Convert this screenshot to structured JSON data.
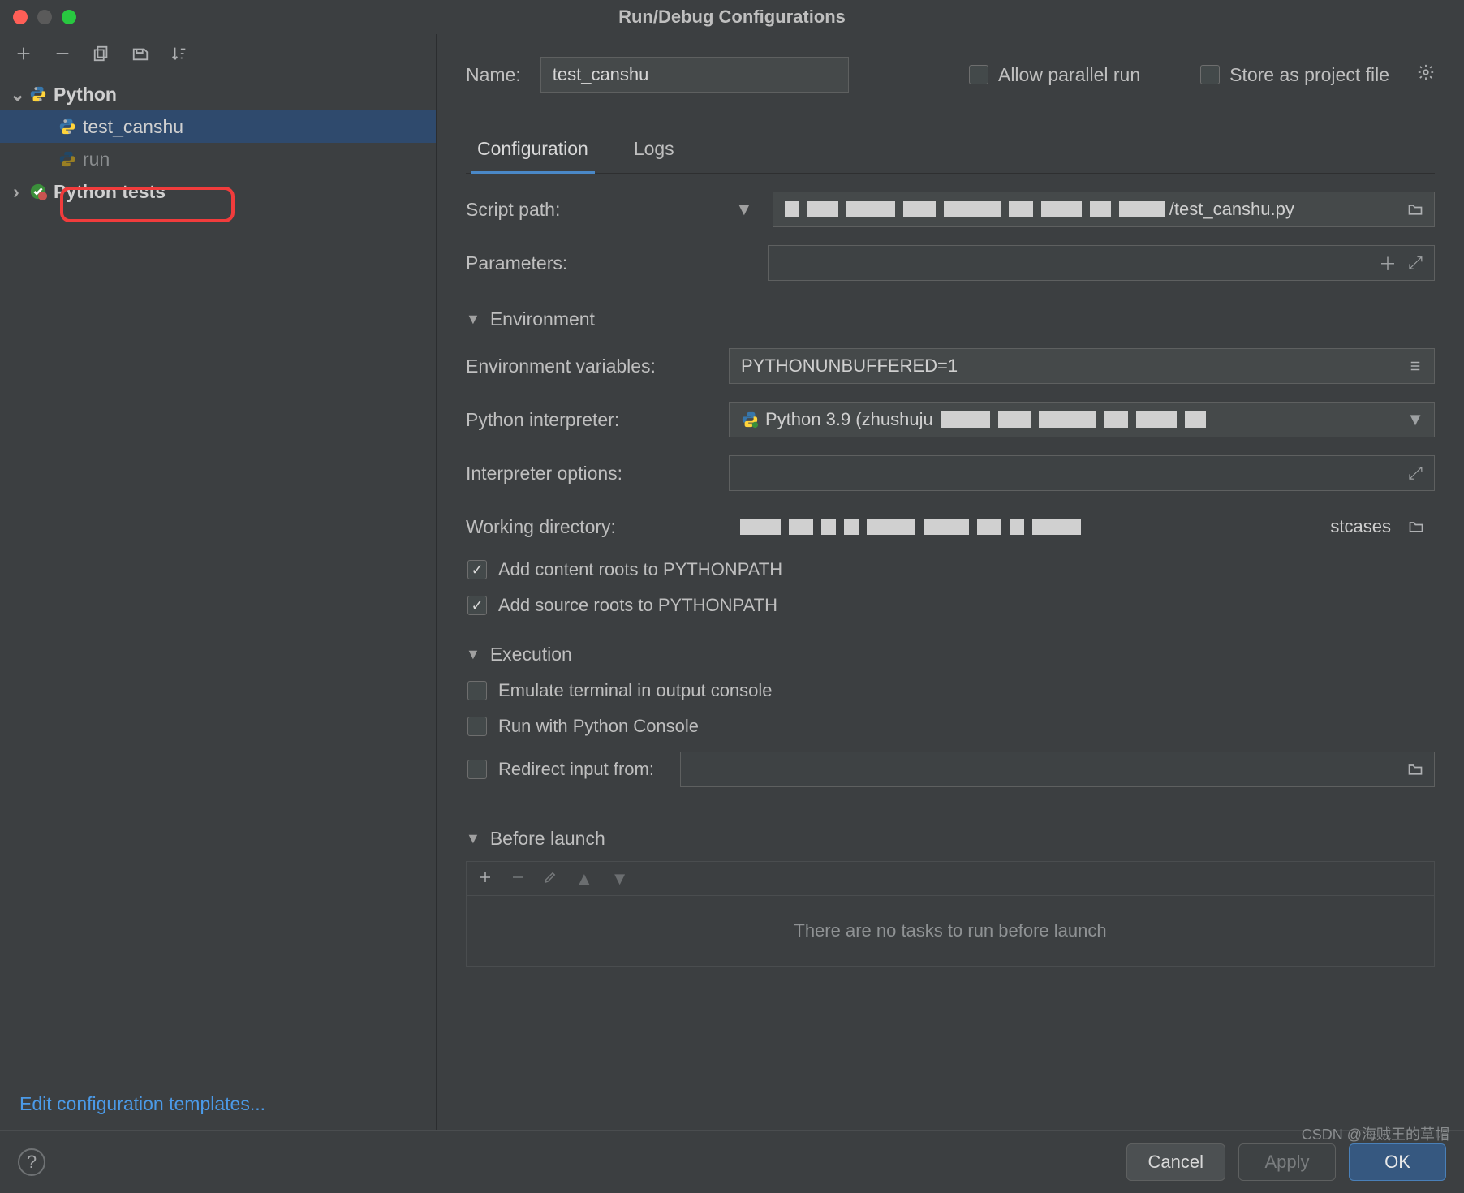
{
  "window": {
    "title": "Run/Debug Configurations"
  },
  "sidebar": {
    "groups": [
      {
        "name": "Python",
        "expanded": true,
        "items": [
          {
            "label": "test_canshu",
            "selected": true
          },
          {
            "label": "run",
            "dim": true
          }
        ]
      },
      {
        "name": "Python tests",
        "expanded": false,
        "items": []
      }
    ],
    "edit_templates": "Edit configuration templates..."
  },
  "form": {
    "name_label": "Name:",
    "name_value": "test_canshu",
    "allow_parallel_label": "Allow parallel run",
    "allow_parallel_checked": false,
    "store_as_project_label": "Store as project file",
    "store_as_project_checked": false,
    "tabs": [
      "Configuration",
      "Logs"
    ],
    "active_tab": 0,
    "script_path_label": "Script path:",
    "script_path_value": "/test_canshu.py",
    "parameters_label": "Parameters:",
    "parameters_value": "",
    "environment_header": "Environment",
    "env_vars_label": "Environment variables:",
    "env_vars_value": "PYTHONUNBUFFERED=1",
    "interpreter_label": "Python interpreter:",
    "interpreter_value": "Python 3.9 (zhushuju",
    "interpreter_options_label": "Interpreter options:",
    "interpreter_options_value": "",
    "working_dir_label": "Working directory:",
    "working_dir_value": "stcases",
    "add_content_roots_label": "Add content roots to PYTHONPATH",
    "add_content_roots_checked": true,
    "add_source_roots_label": "Add source roots to PYTHONPATH",
    "add_source_roots_checked": true,
    "execution_header": "Execution",
    "emulate_terminal_label": "Emulate terminal in output console",
    "emulate_terminal_checked": false,
    "run_with_console_label": "Run with Python Console",
    "run_with_console_checked": false,
    "redirect_input_label": "Redirect input from:",
    "redirect_input_checked": false,
    "redirect_input_value": "",
    "before_launch_header": "Before launch",
    "before_launch_empty": "There are no tasks to run before launch"
  },
  "buttons": {
    "cancel": "Cancel",
    "apply": "Apply",
    "ok": "OK"
  },
  "watermark": "CSDN @海贼王的草帽"
}
